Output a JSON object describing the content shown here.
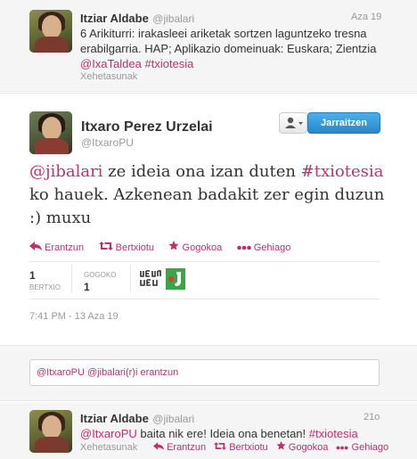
{
  "tweet1": {
    "name": "Itziar Aldabe",
    "handle": "@jibalari",
    "time": "Aza 19",
    "line1": "6  Arikiturri: irakasleei ariketak sortzen laguntzeko tresna",
    "line2": "erabilgarria. HAP; Aplikazio domeinuak: Euskara; Zientzia",
    "mention": "@IxaTaldea",
    "hashtag": "#txiotesia",
    "details": "Xehetasunak"
  },
  "main": {
    "name": "Itxaro Perez Urzelai",
    "handle": "@ItxaroPU",
    "user_menu_icon": "user-icon",
    "follow_label": "Jarraitzen",
    "mention": "@jibalari",
    "text_a": " ze ideia ona izan duten ",
    "hashtag": "#txiotesia",
    "text_b": "ko  hauek. Azkenean badakit zer egin duzun",
    "text_c": ":) muxu",
    "actions": {
      "reply": "Erantzun",
      "retweet": "Bertxiotu",
      "favorite": "Gogokoa",
      "more": "Gehiago"
    },
    "stats": {
      "retweets_count": "1",
      "retweets_label": "BERTXIO",
      "favorites_label": "GOGOKO",
      "favorites_count": "1"
    },
    "timestamp": "7:41 PM - 13 Aza 19"
  },
  "reply": {
    "value": "@ItxaroPU @jibalari(r)i erantzun"
  },
  "tweet3": {
    "name": "Itziar Aldabe",
    "handle": "@jibalari",
    "time": "21o",
    "mention": "@ItxaroPU",
    "text": " baita nik ere! Ideia ona benetan! ",
    "hashtag": "#txiotesia",
    "details": "Xehetasunak",
    "actions": {
      "reply": "Erantzun",
      "retweet": "Bertxiotu",
      "favorite": "Gogokoa",
      "more": "Gehiago"
    }
  },
  "colors": {
    "link": "#c0306a",
    "follow_button": "#2a86c8",
    "background_light": "#f5f5f5"
  }
}
